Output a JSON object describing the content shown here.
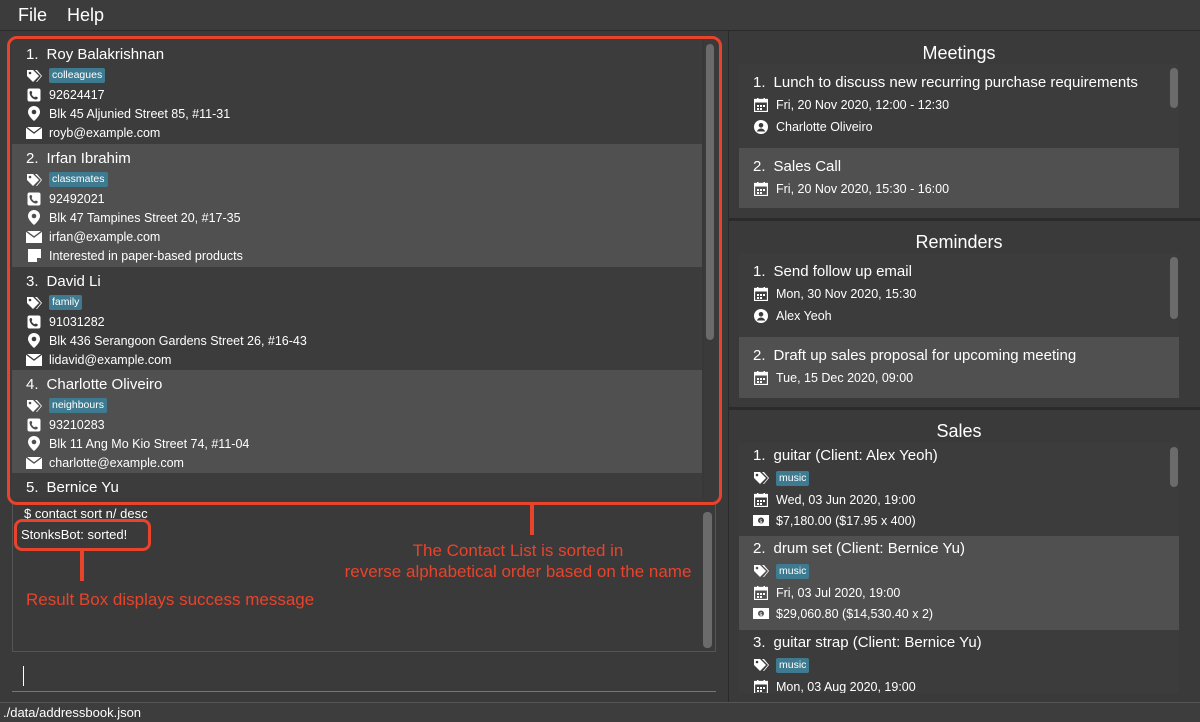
{
  "menu": {
    "file": "File",
    "help": "Help"
  },
  "contacts": [
    {
      "index": "1.",
      "name": "Roy Balakrishnan",
      "tag": "colleagues",
      "phone": "92624417",
      "address": "Blk 45 Aljunied Street 85, #11-31",
      "email": "royb@example.com",
      "remark": ""
    },
    {
      "index": "2.",
      "name": "Irfan Ibrahim",
      "tag": "classmates",
      "phone": "92492021",
      "address": "Blk 47 Tampines Street 20, #17-35",
      "email": "irfan@example.com",
      "remark": "Interested in paper-based products"
    },
    {
      "index": "3.",
      "name": "David Li",
      "tag": "family",
      "phone": "91031282",
      "address": "Blk 436 Serangoon Gardens Street 26, #16-43",
      "email": "lidavid@example.com",
      "remark": ""
    },
    {
      "index": "4.",
      "name": "Charlotte Oliveiro",
      "tag": "neighbours",
      "phone": "93210283",
      "address": "Blk 11 Ang Mo Kio Street 74, #11-04",
      "email": "charlotte@example.com",
      "remark": ""
    },
    {
      "index": "5.",
      "name": "Bernice Yu"
    }
  ],
  "result": {
    "command": "$ contact sort n/ desc",
    "message": "StonksBot: sorted!"
  },
  "annotations": {
    "list_line1": "The Contact List is sorted in",
    "list_line2": "reverse alphabetical order based on the name",
    "result": "Result Box displays success message"
  },
  "status": {
    "path": "./data/addressbook.json"
  },
  "meetings": {
    "title": "Meetings",
    "items": [
      {
        "index": "1.",
        "title": "Lunch to discuss new recurring purchase requirements",
        "datetime": "Fri, 20 Nov 2020, 12:00 - 12:30",
        "person": "Charlotte Oliveiro"
      },
      {
        "index": "2.",
        "title": "Sales Call",
        "datetime": "Fri, 20 Nov 2020, 15:30 - 16:00"
      }
    ]
  },
  "reminders": {
    "title": "Reminders",
    "items": [
      {
        "index": "1.",
        "title": "Send follow up email",
        "datetime": "Mon, 30 Nov 2020, 15:30",
        "person": "Alex Yeoh"
      },
      {
        "index": "2.",
        "title": "Draft up sales proposal for upcoming meeting",
        "datetime": "Tue, 15 Dec 2020, 09:00"
      }
    ]
  },
  "sales": {
    "title": "Sales",
    "items": [
      {
        "index": "1.",
        "title": "guitar (Client: Alex Yeoh)",
        "tag": "music",
        "datetime": "Wed, 03 Jun 2020, 19:00",
        "amount": "$7,180.00 ($17.95 x 400)"
      },
      {
        "index": "2.",
        "title": "drum set (Client: Bernice Yu)",
        "tag": "music",
        "datetime": "Fri, 03 Jul 2020, 19:00",
        "amount": "$29,060.80 ($14,530.40 x 2)"
      },
      {
        "index": "3.",
        "title": "guitar strap (Client: Bernice Yu)",
        "tag": "music",
        "datetime": "Mon, 03 Aug 2020, 19:00"
      }
    ]
  },
  "colors": {
    "annotation": "#e8432b",
    "tag": "#3e7b91",
    "background": "#3a3a3a"
  }
}
